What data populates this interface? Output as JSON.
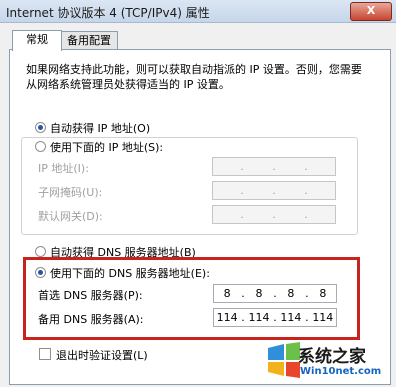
{
  "window": {
    "title": "Internet 协议版本 4 (TCP/IPv4) 属性",
    "close_label": "X"
  },
  "tabs": [
    {
      "label": "常规",
      "selected": true
    },
    {
      "label": "备用配置",
      "selected": false
    }
  ],
  "description": "如果网络支持此功能，则可以获取自动指派的 IP 设置。否则，您需要从网络系统管理员处获得适当的 IP 设置。",
  "ip": {
    "auto_label": "自动获得 IP 地址(O)",
    "auto_selected": true,
    "manual_label": "使用下面的 IP 地址(S):",
    "fields": [
      {
        "label": "IP 地址(I):",
        "octets": [
          "",
          ".",
          ".",
          "."
        ]
      },
      {
        "label": "子网掩码(U):",
        "octets": [
          "",
          ".",
          ".",
          "."
        ]
      },
      {
        "label": "默认网关(D):",
        "octets": [
          "",
          ".",
          ".",
          "."
        ]
      }
    ]
  },
  "dns": {
    "auto_label": "自动获得 DNS 服务器地址(B)",
    "manual_label": "使用下面的 DNS 服务器地址(E):",
    "manual_selected": true,
    "preferred_label": "首选 DNS 服务器(P):",
    "preferred_octets": [
      "8",
      ".",
      "8",
      ".",
      "8",
      ".",
      "8"
    ],
    "alternate_label": "备用 DNS 服务器(A):",
    "alternate_octets": [
      "114",
      ".",
      "114",
      ".",
      "114",
      ".",
      "114"
    ]
  },
  "validate_label": "退出时验证设置(L)",
  "watermark": {
    "line1": "系统之家",
    "line2": "Win10net.com"
  },
  "colors": {
    "highlight": "#c8231c",
    "radio_dot": "#2a55a0"
  }
}
